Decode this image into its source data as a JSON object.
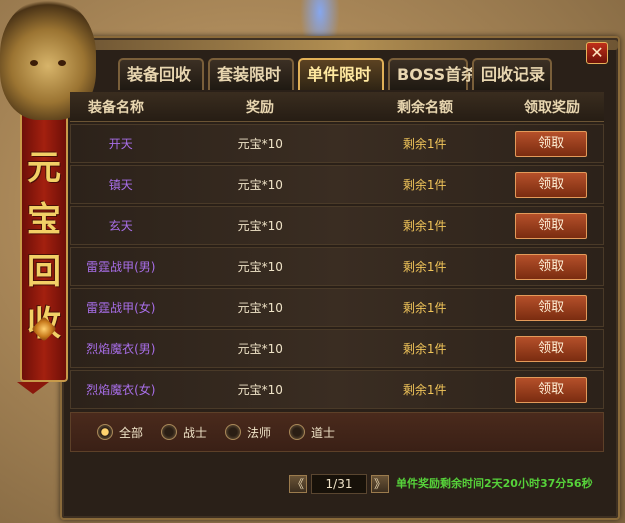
{
  "window": {
    "banner_title": "元宝回收",
    "close_label": "✕"
  },
  "tabs": [
    {
      "label": "装备回收",
      "active": false
    },
    {
      "label": "套装限时",
      "active": false
    },
    {
      "label": "单件限时",
      "active": true
    },
    {
      "label": "BOSS首杀",
      "active": false
    },
    {
      "label": "回收记录",
      "active": false
    }
  ],
  "table": {
    "headers": [
      "装备名称",
      "奖励",
      "剩余名额",
      "领取奖励"
    ],
    "rows": [
      {
        "name": "开天",
        "reward": "元宝*10",
        "remaining": "剩余1件",
        "button": "领取"
      },
      {
        "name": "镇天",
        "reward": "元宝*10",
        "remaining": "剩余1件",
        "button": "领取"
      },
      {
        "name": "玄天",
        "reward": "元宝*10",
        "remaining": "剩余1件",
        "button": "领取"
      },
      {
        "name": "雷霆战甲(男)",
        "reward": "元宝*10",
        "remaining": "剩余1件",
        "button": "领取"
      },
      {
        "name": "雷霆战甲(女)",
        "reward": "元宝*10",
        "remaining": "剩余1件",
        "button": "领取"
      },
      {
        "name": "烈焰魔衣(男)",
        "reward": "元宝*10",
        "remaining": "剩余1件",
        "button": "领取"
      },
      {
        "name": "烈焰魔衣(女)",
        "reward": "元宝*10",
        "remaining": "剩余1件",
        "button": "领取"
      }
    ]
  },
  "filters": [
    {
      "label": "全部",
      "checked": true
    },
    {
      "label": "战士",
      "checked": false
    },
    {
      "label": "法师",
      "checked": false
    },
    {
      "label": "道士",
      "checked": false
    }
  ],
  "pager": {
    "prev": "《",
    "next": "》",
    "page": "1/31"
  },
  "countdown": "单件奖励剩余时间2天20小时37分56秒",
  "colors": {
    "item_name": "#a86ee8",
    "remaining": "#f1c55a",
    "countdown": "#56d23a"
  }
}
